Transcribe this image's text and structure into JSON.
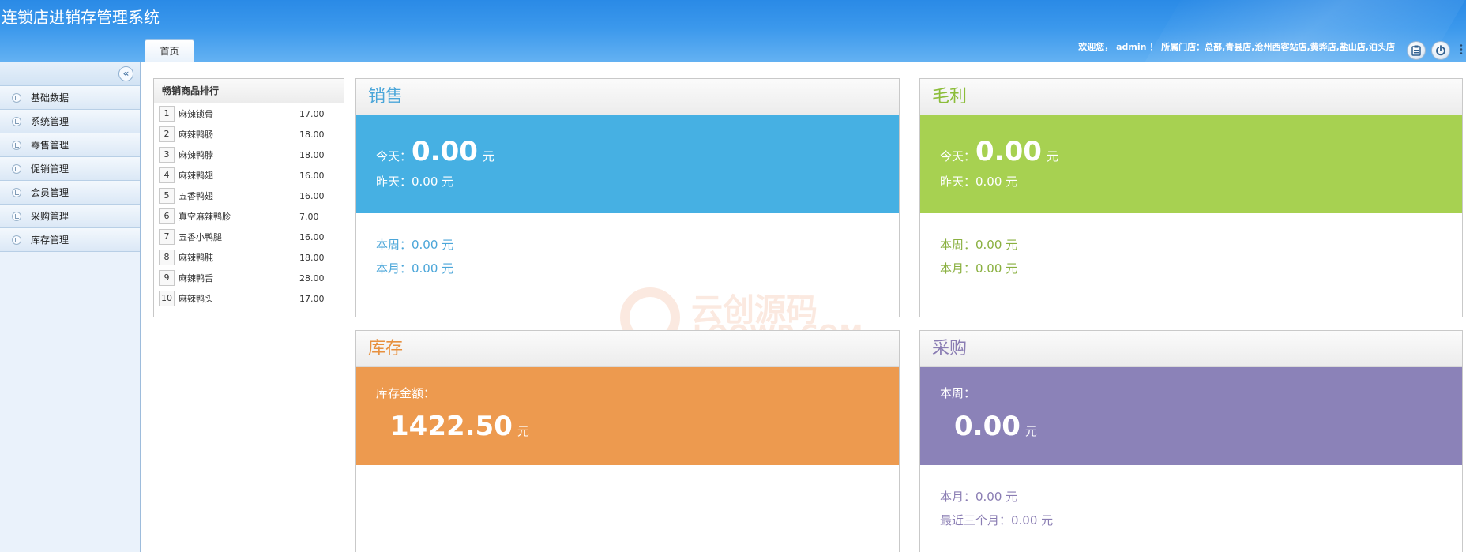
{
  "app": {
    "title": "连锁店进销存管理系统"
  },
  "tabs": [
    {
      "label": "首页"
    }
  ],
  "header": {
    "welcome": "欢迎您， admin ！ 所属门店：总部,青县店,沧州西客站店,黄骅店,盐山店,泊头店",
    "icons": [
      "clipboard-icon",
      "power-icon"
    ]
  },
  "sidebar": {
    "collapse_glyph": "«",
    "items": [
      {
        "label": "基础数据"
      },
      {
        "label": "系统管理"
      },
      {
        "label": "零售管理"
      },
      {
        "label": "促销管理"
      },
      {
        "label": "会员管理"
      },
      {
        "label": "采购管理"
      },
      {
        "label": "库存管理"
      }
    ]
  },
  "ranking": {
    "title": "畅销商品排行",
    "rows": [
      {
        "rank": "1",
        "name": "麻辣锁骨",
        "price": "17.00"
      },
      {
        "rank": "2",
        "name": "麻辣鸭肠",
        "price": "18.00"
      },
      {
        "rank": "3",
        "name": "麻辣鸭脖",
        "price": "18.00"
      },
      {
        "rank": "4",
        "name": "麻辣鸭翅",
        "price": "16.00"
      },
      {
        "rank": "5",
        "name": "五香鸭翅",
        "price": "16.00"
      },
      {
        "rank": "6",
        "name": "真空麻辣鸭胗",
        "price": "7.00"
      },
      {
        "rank": "7",
        "name": "五香小鸭腿",
        "price": "16.00"
      },
      {
        "rank": "8",
        "name": "麻辣鸭肫",
        "price": "18.00"
      },
      {
        "rank": "9",
        "name": "麻辣鸭舌",
        "price": "28.00"
      },
      {
        "rank": "10",
        "name": "麻辣鸭头",
        "price": "17.00"
      }
    ]
  },
  "cards": {
    "sales": {
      "title": "销售",
      "today_label": "今天：",
      "today_value": "0.00",
      "today_unit": "元",
      "yesterday": "昨天：0.00 元",
      "week": "本周：0.00 元",
      "month": "本月：0.00 元",
      "color": "#46b0e3"
    },
    "gross": {
      "title": "毛利",
      "today_label": "今天：",
      "today_value": "0.00",
      "today_unit": "元",
      "yesterday": "昨天：0.00 元",
      "week": "本周：0.00 元",
      "month": "本月：0.00 元",
      "color": "#a7d151"
    },
    "stock": {
      "title": "库存",
      "amount_label": "库存金额：",
      "amount_value": "1422.50",
      "amount_unit": "元",
      "color": "#ed9a4f"
    },
    "purchase": {
      "title": "采购",
      "week_label": "本周：",
      "week_value": "0.00",
      "week_unit": "元",
      "month": "本月：0.00 元",
      "three_months": "最近三个月：0.00 元",
      "color": "#8b82b8"
    }
  },
  "watermark": {
    "brand": "云创源码",
    "site": "LOOWP.COM"
  }
}
